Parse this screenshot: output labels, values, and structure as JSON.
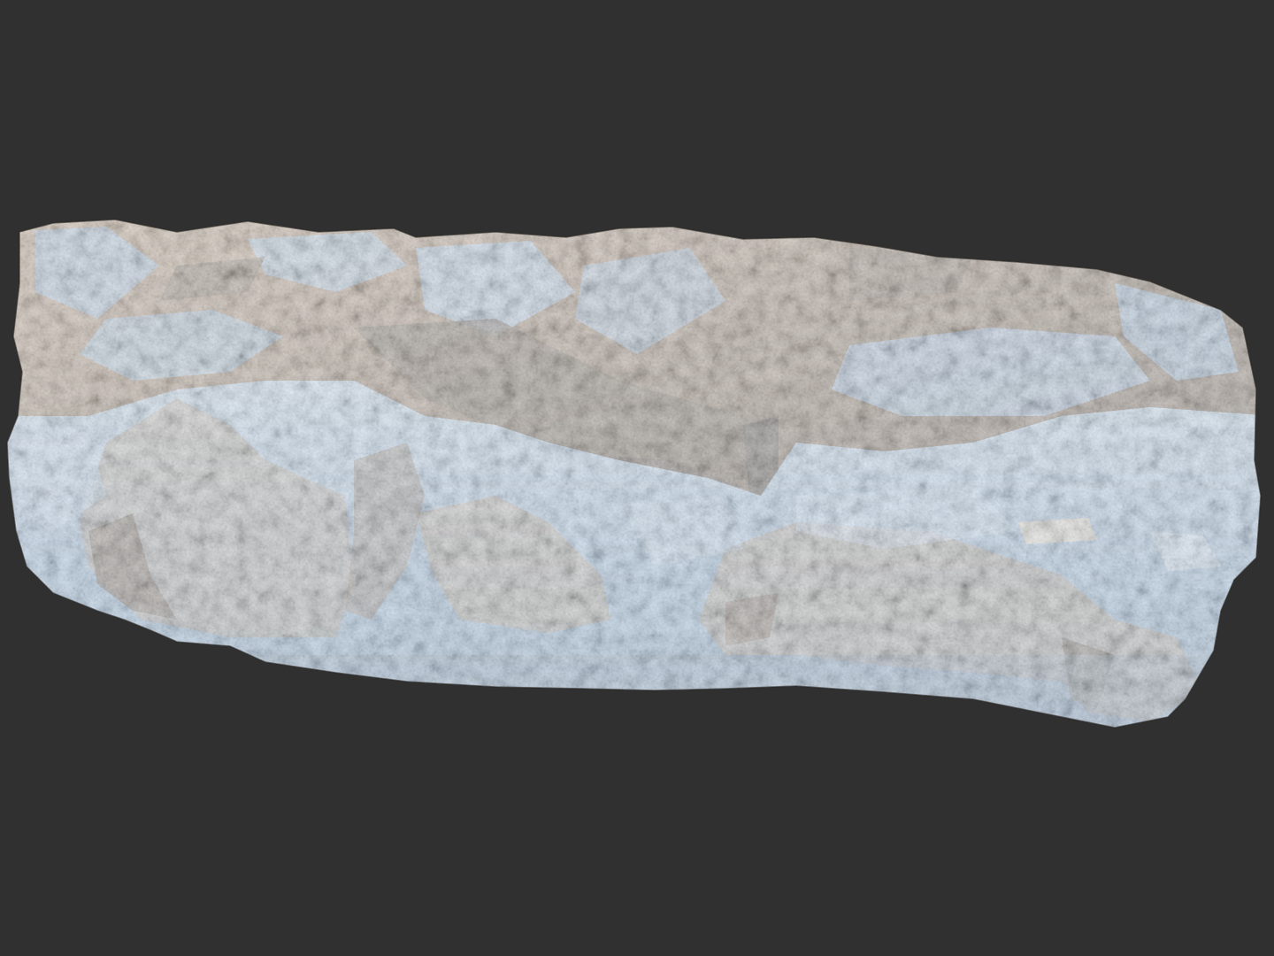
{
  "viewport": {
    "background_color": "#303030"
  },
  "model": {
    "subject": "rock-surface-scan",
    "render_style": "matcap-shaded-mesh",
    "colors": {
      "light_facing": "#6f9cc8",
      "light_highlight": "#a9c7e3",
      "shadow_brown": "#5a4634",
      "dark_crevice": "#1f1914",
      "bronze_mid": "#8c7358"
    }
  }
}
